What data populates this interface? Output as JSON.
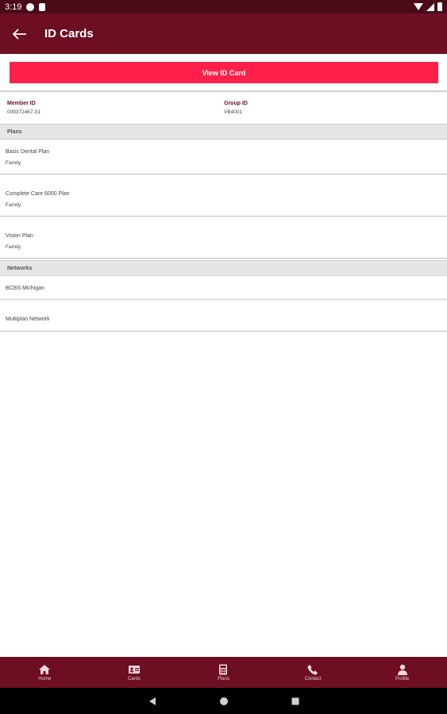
{
  "status_bar": {
    "time": "3:19"
  },
  "app_bar": {
    "title": "ID Cards"
  },
  "view_button": {
    "label": "View ID Card"
  },
  "ids": {
    "member_label": "Member ID",
    "member_value": "009372467-01",
    "group_label": "Group ID",
    "group_value": "VB4001"
  },
  "plans": {
    "header": "Plans",
    "items": [
      {
        "name": "Basic Dental Plan",
        "coverage": "Family"
      },
      {
        "name": "Complete Care 6000 Plan",
        "coverage": "Family"
      },
      {
        "name": "Vision Plan",
        "coverage": "Family"
      }
    ]
  },
  "networks": {
    "header": "Networks",
    "items": [
      {
        "name": "BCBS Michigan"
      },
      {
        "name": "Multiplan Network"
      }
    ]
  },
  "bottom_nav": [
    {
      "label": "Home",
      "icon": "home-icon"
    },
    {
      "label": "Cards",
      "icon": "card-icon"
    },
    {
      "label": "Plans",
      "icon": "calculator-icon"
    },
    {
      "label": "Contact",
      "icon": "phone-icon"
    },
    {
      "label": "Profile",
      "icon": "person-icon"
    }
  ],
  "colors": {
    "app_bar": "#6e0e22",
    "status_bar": "#4a0a17",
    "accent_button": "#ff1f4b",
    "section_bg": "#e6e6e6"
  }
}
